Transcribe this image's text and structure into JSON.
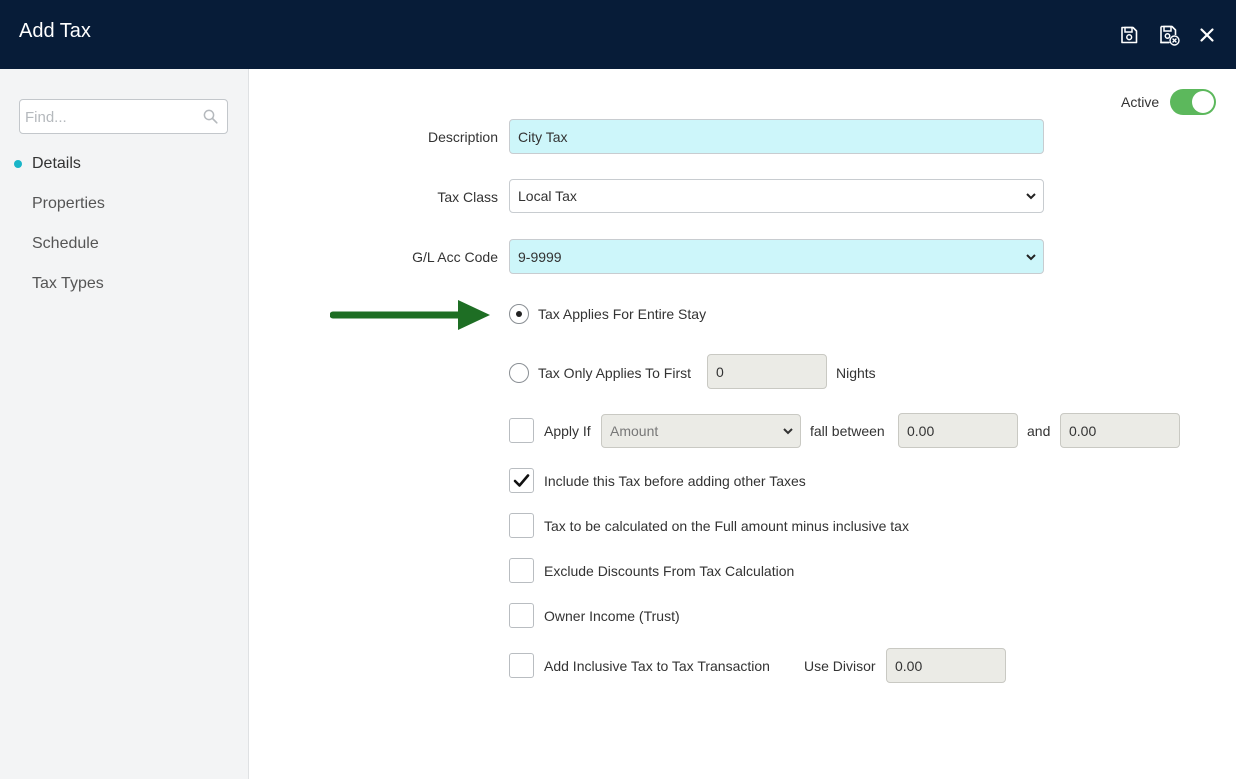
{
  "header": {
    "title": "Add Tax"
  },
  "sidebar": {
    "search_placeholder": "Find...",
    "items": [
      {
        "label": "Details",
        "active": true
      },
      {
        "label": "Properties",
        "active": false
      },
      {
        "label": "Schedule",
        "active": false
      },
      {
        "label": "Tax Types",
        "active": false
      }
    ]
  },
  "form": {
    "active_label": "Active",
    "active_on": true,
    "description": {
      "label": "Description",
      "value": "City Tax"
    },
    "tax_class": {
      "label": "Tax Class",
      "value": "Local Tax"
    },
    "gl_acc_code": {
      "label": "G/L Acc Code",
      "value": "9-9999"
    },
    "entire_stay": {
      "label": "Tax Applies For Entire Stay",
      "selected": true
    },
    "first_nights": {
      "label": "Tax Only Applies To First",
      "value": "0",
      "suffix": "Nights",
      "selected": false
    },
    "apply_if": {
      "label": "Apply If",
      "checked": false,
      "select_value": "Amount",
      "between_label": "fall between",
      "from": "0.00",
      "and_label": "and",
      "to": "0.00"
    },
    "include_before": {
      "label": "Include this Tax before adding other Taxes",
      "checked": true
    },
    "full_minus": {
      "label": "Tax to be calculated on the Full amount minus inclusive tax",
      "checked": false
    },
    "exclude_discounts": {
      "label": "Exclude Discounts From Tax Calculation",
      "checked": false
    },
    "owner_income": {
      "label": "Owner Income (Trust)",
      "checked": false
    },
    "add_inclusive": {
      "label": "Add Inclusive Tax to Tax Transaction",
      "checked": false,
      "divisor_label": "Use Divisor",
      "divisor": "0.00"
    }
  },
  "colors": {
    "header_bg": "#071c38",
    "accent": "#19b5c8",
    "toggle_on": "#5cb85c",
    "arrow": "#1e6e24",
    "highlight_field": "#cdf6fa"
  }
}
